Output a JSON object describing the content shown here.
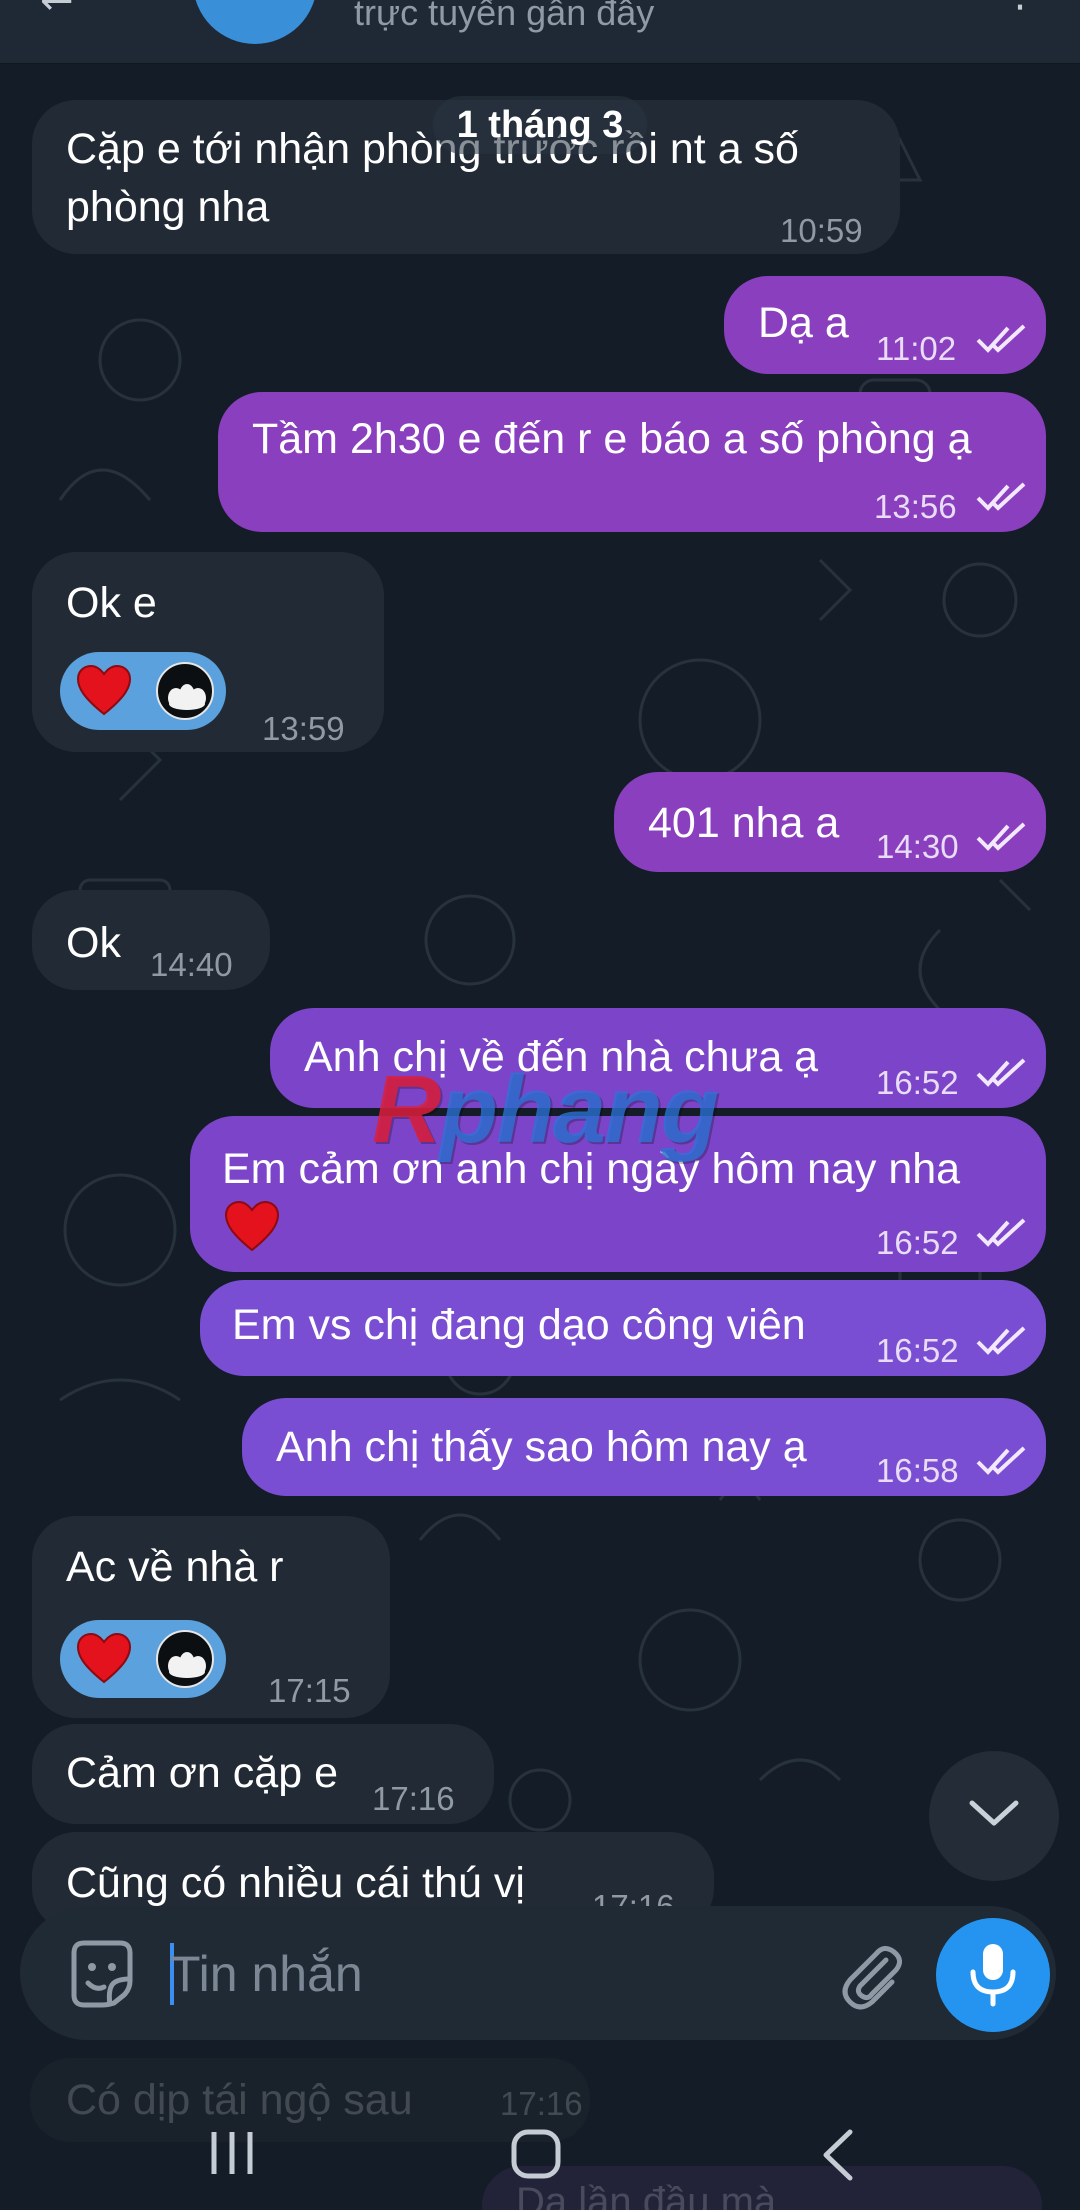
{
  "header": {
    "status": "trực tuyến gần đây"
  },
  "date_label": "1 tháng 3",
  "messages": [
    {
      "text_line1": "Cặp e tới nhận phòng trước rồi nt a số",
      "text_line2": "phòng nha",
      "time": "10:59"
    },
    {
      "text": "Dạ a",
      "time": "11:02"
    },
    {
      "text": "Tầm 2h30 e đến r e báo a số phòng ạ",
      "time": "13:56"
    },
    {
      "text": "Ok e",
      "time": "13:59"
    },
    {
      "text": "401 nha a",
      "time": "14:30"
    },
    {
      "text": "Ok",
      "time": "14:40"
    },
    {
      "text": "Anh chị về đến nhà chưa ạ",
      "time": "16:52"
    },
    {
      "text": "Em cảm ơn anh chị ngày hôm nay nha",
      "time": "16:52"
    },
    {
      "text": "Em vs chị đang dạo công viên",
      "time": "16:52"
    },
    {
      "text": "Anh chị thấy sao hôm nay ạ",
      "time": "16:58"
    },
    {
      "text": "Ac về nhà r",
      "time": "17:15"
    },
    {
      "text": "Cảm ơn cặp e",
      "time": "17:16"
    },
    {
      "text": "Cũng có nhiều cái thú vị",
      "time": "17:16"
    }
  ],
  "faded_messages": {
    "behind_1": "Có dịp tái ngộ sau",
    "behind_1_time": "17:16",
    "behind_2": "Dạ lần đầu mà"
  },
  "watermark": {
    "part1": "R",
    "part2": "phang"
  },
  "composer": {
    "placeholder": "Tin nhắn"
  },
  "colors": {
    "background": "#141d27",
    "incoming_bubble": "#222b35",
    "outgoing_bubble": "#8a3fbe",
    "accent": "#2594f0"
  },
  "icons": {
    "reaction_emoji": "red-heart",
    "sticker": "sticker-icon",
    "attach": "paperclip-icon",
    "mic": "microphone-icon",
    "scroll": "chevron-down-icon"
  }
}
